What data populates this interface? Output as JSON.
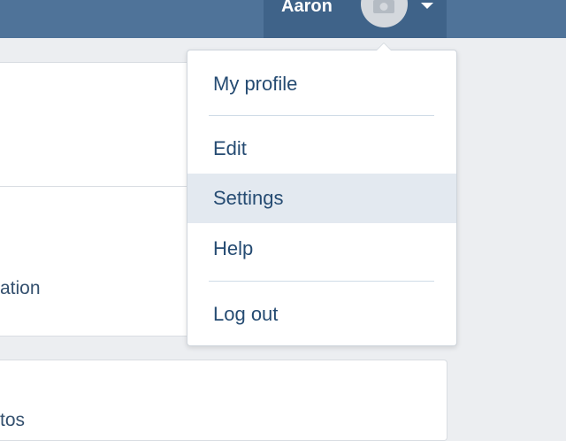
{
  "header": {
    "username": "Aaron",
    "avatar_icon": "camera-icon",
    "menu_toggle_icon": "caret-down-icon"
  },
  "background_cards": [
    {
      "text": ""
    },
    {
      "text": "ation"
    },
    {
      "text": "tos"
    }
  ],
  "dropdown": {
    "items": [
      {
        "label": "My profile"
      },
      {
        "label": "Edit"
      },
      {
        "label": "Settings",
        "highlighted": true
      },
      {
        "label": "Help"
      },
      {
        "label": "Log out"
      }
    ]
  },
  "colors": {
    "topbar": "#4f7399",
    "user_menu_bg": "#3f6389",
    "menu_text": "#254b72",
    "highlight_bg": "#e3e9f0",
    "page_bg": "#eceef1"
  }
}
